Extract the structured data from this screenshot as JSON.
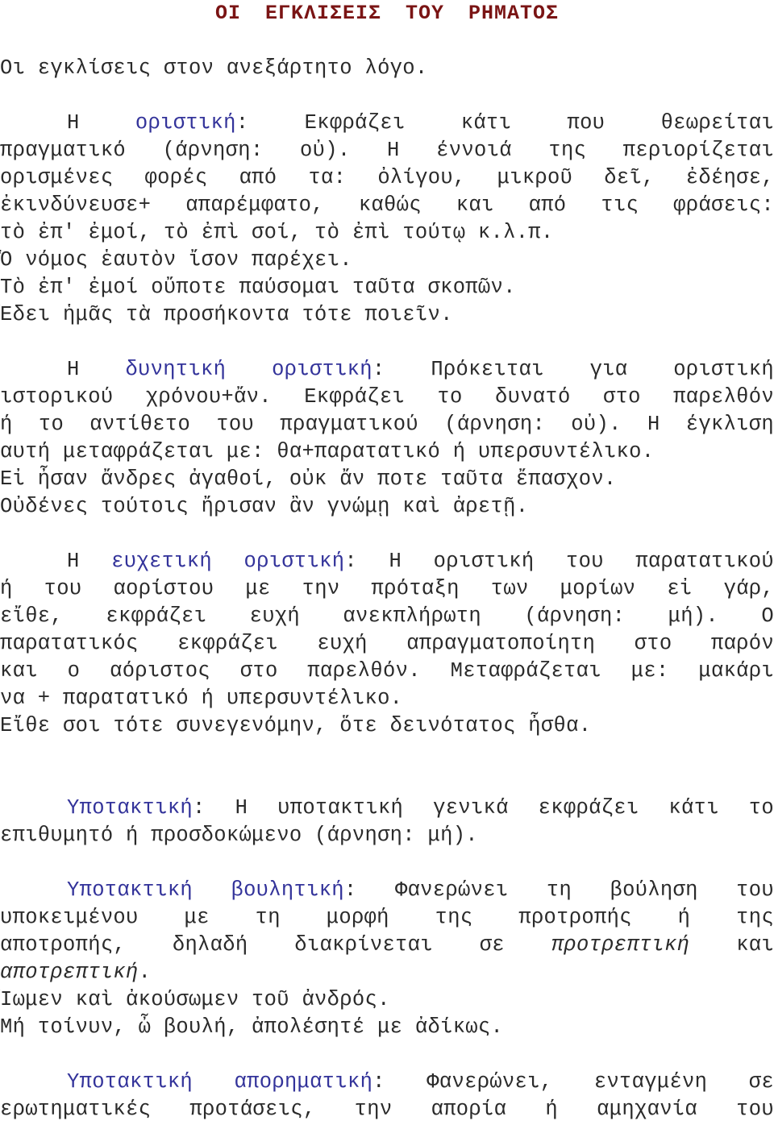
{
  "title": "ΟΙ  ΕΓΚΛΙΣΕΙΣ  ΤΟΥ  ΡΗΜΑΤΟΣ",
  "intro": "Οι εγκλίσεις στον ανεξάρτητο λόγο.",
  "sections": {
    "oristiki": {
      "lead": "Η",
      "term": "οριστική",
      "colon": ":",
      "lines": [
        " Εκφράζει κάτι που θεωρείται",
        "πραγματικό (άρνηση: οὐ). Η έννοιά της περιορίζεται",
        "ορισμένες φορές από τα: ὀλίγου, μικροῦ δεῖ, ἐδέησε,",
        "ἐκινδύνευσε+ απαρέμφατο, καθώς και από τις φράσεις:",
        "τὸ ἐπ' ἐμοί, τὸ ἐπὶ σοί, τὸ ἐπὶ τούτῳ κ.λ.π.",
        "Ὁ νόμος ἑαυτὸν ἴσον παρέχει.",
        "Τὸ ἐπ' ἐμοί οὔποτε παύσομαι ταῦτα σκοπῶν.",
        "Ἔδει ἡμᾶς τὰ προσήκοντα τότε ποιεῖν."
      ]
    },
    "dynitiki": {
      "lead": "Η",
      "term": "δυνητική  οριστική",
      "colon": ":",
      "lines": [
        " Πρόκειται για οριστική",
        "ιστορικού χρόνου+ἄν. Εκφράζει το δυνατό στο παρελθόν",
        "ή το αντίθετο του πραγματικού (άρνηση: οὐ). Η έγκλιση",
        "αυτή μεταφράζεται με: θα+παρατατικό ή υπερσυντέλικο.",
        "Εἰ ἦσαν ἄνδρες ἀγαθοί, οὐκ ἄν ποτε ταῦτα ἔπασχον.",
        "Οὐδένες τούτοις ἤρισαν ἂν γνώμῃ καὶ ἀρετῇ."
      ]
    },
    "efchetiki": {
      "lead": "Η",
      "term": "ευχετική οριστική",
      "colon": ":",
      "lines": [
        " Η οριστική του παρατατικού",
        "ή του αορίστου με την πρόταξη των μορίων εἰ γάρ,",
        "εἴθε, εκφράζει ευχή ανεκπλήρωτη (άρνηση: μή). Ο",
        "παρατατικός εκφράζει ευχή απραγματοποίητη στο παρόν",
        "και ο αόριστος στο παρελθόν. Μεταφράζεται με: μακάρι",
        "να + παρατατικό ή υπερσυντέλικο.",
        "Εἴθε σοι τότε συνεγενόμην, ὅτε δεινότατος ἦσθα."
      ]
    },
    "ypotaktiki": {
      "term": "Υποτακτική",
      "colon": ":",
      "lines": [
        " Η υποτακτική γενικά εκφράζει κάτι το",
        "επιθυμητό ή προσδοκώμενο (άρνηση: μή)."
      ]
    },
    "vouliti": {
      "term": "Υποτακτική βουλητική",
      "colon": ":",
      "lines": [
        " Φανερώνει τη βούληση του",
        "υποκειμένου με τη μορφή της προτροπής ή της"
      ],
      "line3_pre": "αποτροπής, δηλαδή διακρίνεται σε ",
      "line3_it": "προτρεπτική",
      "line3_post": " και",
      "line4_it": "αποτρεπτική",
      "line4_post": ".",
      "examples": [
        "Ἴωμεν καὶ ἀκούσωμεν τοῦ ἀνδρός.",
        "Μή τοίνυν, ὦ βουλή, ἀπολέσητέ με ἀδίκως."
      ]
    },
    "aporimatiki": {
      "term": "Υποτακτική απορηματική",
      "colon": ":",
      "lines": [
        " Φανερώνει, ενταγμένη σε",
        "ερωτηματικές προτάσεις, την απορία ή αμηχανία του"
      ]
    }
  }
}
